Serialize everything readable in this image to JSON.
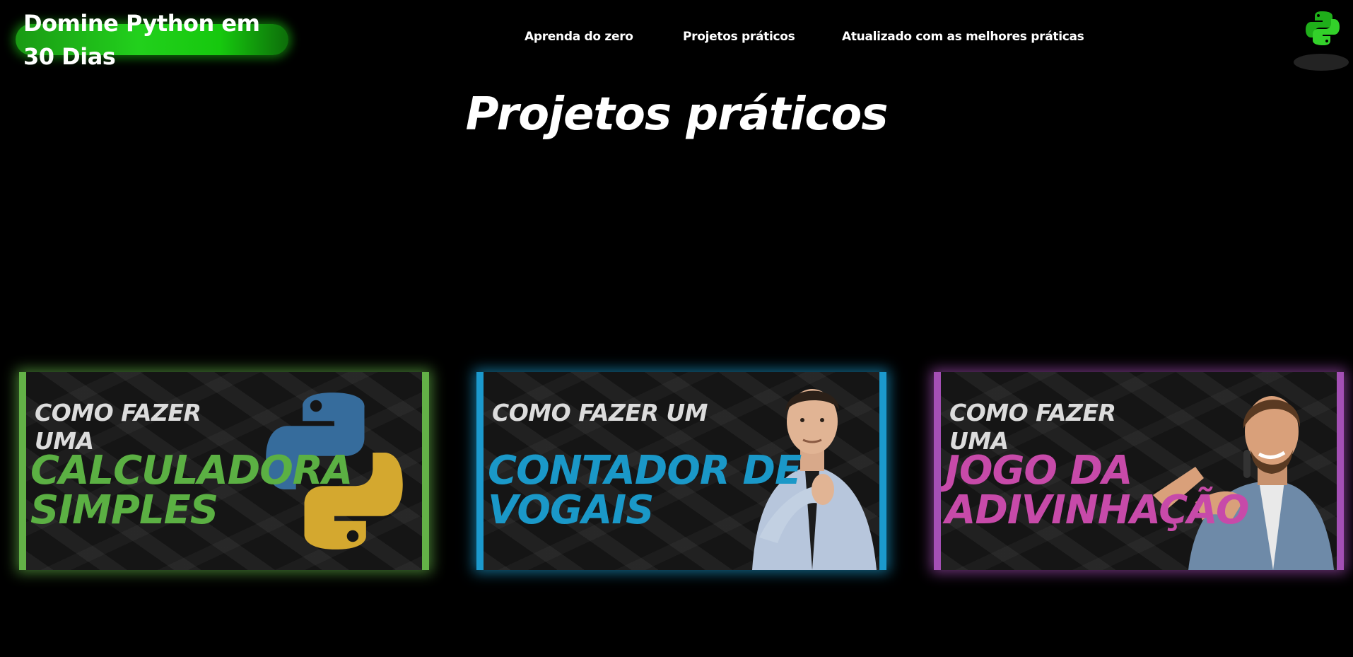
{
  "header": {
    "logo_text": "Domine Python em 30 Dias",
    "nav": [
      {
        "label": "Aprenda do zero"
      },
      {
        "label": "Projetos práticos"
      },
      {
        "label": "Atualizado com as melhores práticas"
      }
    ],
    "brand_icon": "python-logo-icon"
  },
  "section": {
    "title": "Projetos práticos"
  },
  "cards": [
    {
      "pre": "COMO FAZER UMA",
      "main": "CALCULADORA SIMPLES",
      "accent": "#63b147",
      "art": "python-logo-icon"
    },
    {
      "pre": "COMO FAZER UM",
      "main": "CONTADOR DE VOGAIS",
      "accent": "#1b99cd",
      "art": "thinking-man-image"
    },
    {
      "pre": "COMO FAZER UMA",
      "main": "JOGO DA ADIVINHAÇÃO",
      "accent": "#a44fb5",
      "art": "presenter-man-image"
    }
  ],
  "colors": {
    "background": "#000000",
    "logo_green": "#22d01c"
  }
}
